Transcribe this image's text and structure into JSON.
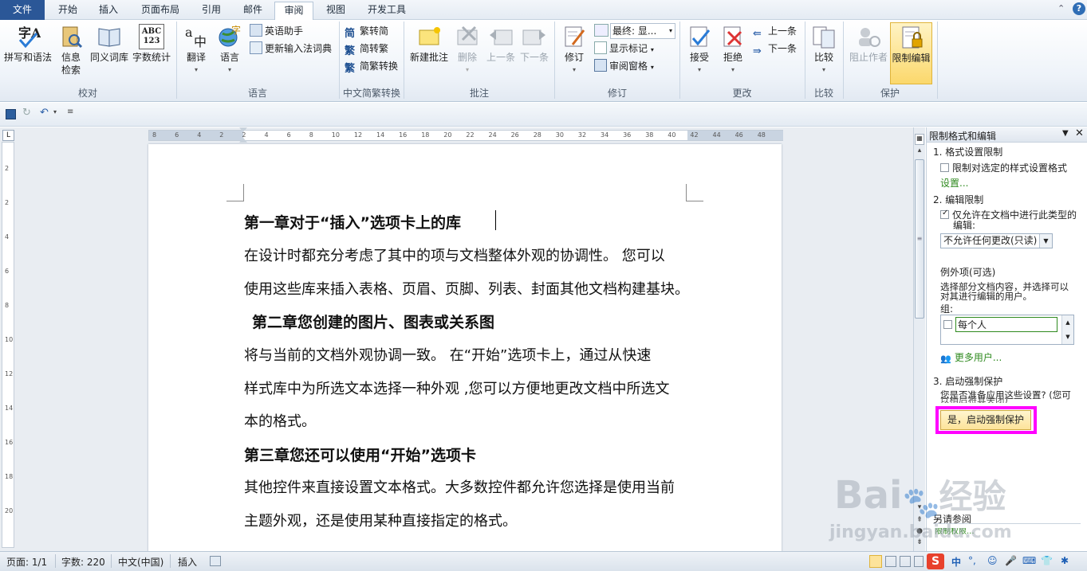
{
  "tabs": [
    "文件",
    "开始",
    "插入",
    "页面布局",
    "引用",
    "邮件",
    "审阅",
    "视图",
    "开发工具"
  ],
  "ribbon": {
    "proofing": {
      "spell": "拼写和语法",
      "info_1": "信息",
      "info_2": "检索",
      "thesaurus": "同义词库",
      "wordcount": "字数统计",
      "wordcount_icon": "ABC\n123",
      "group": "校对"
    },
    "language": {
      "translate": "翻译",
      "language": "语言",
      "english": "英语助手",
      "ime": "更新输入法词典",
      "group": "语言"
    },
    "chinese": {
      "t2s": "繁转简",
      "s2t": "简转繁",
      "convert": "简繁转换",
      "group": "中文简繁转换"
    },
    "comments": {
      "new": "新建批注",
      "delete": "删除",
      "prev": "上一条",
      "next": "下一条",
      "group": "批注"
    },
    "tracking": {
      "track": "修订",
      "final": "最终: 显...",
      "markup": "显示标记",
      "pane": "审阅窗格",
      "group": "修订"
    },
    "changes": {
      "accept": "接受",
      "reject": "拒绝",
      "prev": "上一条",
      "next": "下一条",
      "group": "更改"
    },
    "compare": {
      "compare": "比较",
      "group": "比较"
    },
    "protect": {
      "block": "阻止作者",
      "restrict": "限制编辑",
      "group": "保护"
    }
  },
  "ruler_numbers": [
    "8",
    "6",
    "4",
    "2",
    "2",
    "4",
    "6",
    "8",
    "10",
    "12",
    "14",
    "16",
    "18",
    "20",
    "22",
    "24",
    "26",
    "28",
    "30",
    "32",
    "34",
    "36",
    "38",
    "40",
    "42",
    "44",
    "46",
    "48"
  ],
  "vruler_numbers": [
    "2",
    "2",
    "4",
    "6",
    "8",
    "10",
    "12",
    "14",
    "16",
    "18",
    "20"
  ],
  "document": {
    "h1": "第一章对于“插入”选项卡上的库",
    "p1a": "在设计时都充分考虑了其中的项与文档整体外观的协调性。 您可以",
    "p1b": "使用这些库来插入表格、页眉、页脚、列表、封面其他文档构建基块。",
    "h2": "第二章您创建的图片、图表或关系图",
    "p2a": "将与当前的文档外观协调一致。 在“开始”选项卡上，通过从快速",
    "p2b": "样式库中为所选文本选择一种外观 ,您可以方便地更改文档中所选文",
    "p2c": "本的格式。",
    "h3": "第三章您还可以使用“开始”选项卡",
    "p3a": "其他控件来直接设置文本格式。大多数控件都允许您选择是使用当前",
    "p3b": "主题外观，还是使用某种直接指定的格式。"
  },
  "pane": {
    "title": "限制格式和编辑",
    "s1": "1. 格式设置限制",
    "s1_check": "限制对选定的样式设置格式",
    "s1_link": "设置...",
    "s2": "2. 编辑限制",
    "s2_check_1": "仅允许在文档中进行此类型的",
    "s2_check_2": "编辑:",
    "s2_select": "不允许任何更改(只读)",
    "exceptions": "例外项(可选)",
    "exc_desc_1": "选择部分文档内容，并选择可以",
    "exc_desc_2": "对其进行编辑的用户。",
    "groups": "组:",
    "everyone": "每个人",
    "more_users": "更多用户...",
    "s3": "3. 启动强制保护",
    "s3_desc_1": "您是否准备应用这些设置? (您可",
    "s3_desc_2": "以稍后将其关闭)",
    "start_button": "是，启动强制保护",
    "see_also": "另请参阅",
    "see_also_link": "限制权限..."
  },
  "status": {
    "page": "页面: 1/1",
    "words": "字数: 220",
    "lang": "中文(中国)",
    "mode": "插入"
  },
  "watermark": {
    "brand": "Bai",
    "brand2": "经验",
    "url": "jingyan.baidu.com"
  },
  "tray": [
    "中",
    "°,",
    "☺",
    "🎤",
    "⌨",
    "👕",
    "✱"
  ],
  "colors": {
    "highlight": "#ff00ff",
    "button_fill": "#fde9a6",
    "active_tab": "#ffffff",
    "file_tab": "#2b5797"
  }
}
